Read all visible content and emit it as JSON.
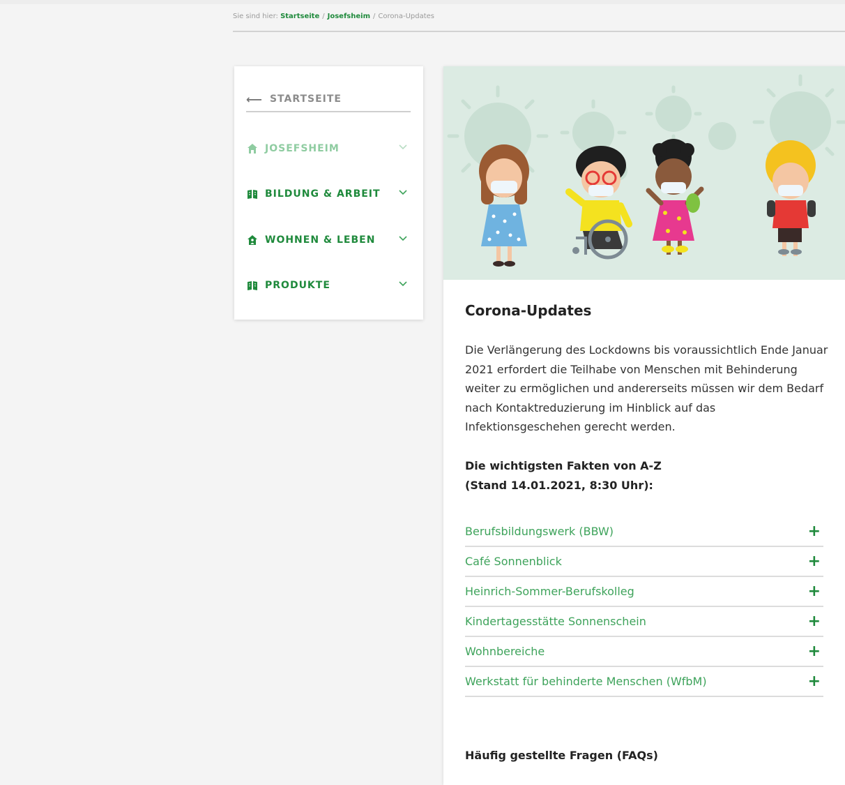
{
  "breadcrumb": {
    "prefix": "Sie sind hier:",
    "items": [
      "Startseite",
      "Josefsheim",
      "Corona-Updates"
    ],
    "separator": "/"
  },
  "sidebar": {
    "back_label": "STARTSEITE",
    "back_icon": "arrow-left-icon",
    "items": [
      {
        "label": "JOSEFSHEIM",
        "icon": "home-icon"
      },
      {
        "label": "BILDUNG & ARBEIT",
        "icon": "book-icon"
      },
      {
        "label": "WOHNEN & LEBEN",
        "icon": "house-person-icon"
      },
      {
        "label": "PRODUKTE",
        "icon": "book-icon"
      }
    ]
  },
  "hero": {
    "image": "children-with-masks-illustration"
  },
  "article": {
    "title": "Corona-Updates",
    "intro": "Die Verlängerung des Lockdowns bis voraussichtlich Ende Januar 2021 erfordert die Teilhabe von Menschen mit Behinderung weiter zu ermöglichen und andererseits müssen wir dem Bedarf nach Kontaktreduzierung im Hinblick auf das Infektionsgeschehen gerecht werden.",
    "facts_line1": "Die wichtigsten Fakten von A-Z",
    "facts_line2": "(Stand 14.01.2021, 8:30 Uhr):"
  },
  "accordion": {
    "expand_symbol": "+",
    "items": [
      "Berufsbildungswerk (BBW)",
      "Café Sonnenblick",
      "Heinrich-Sommer-Berufskolleg",
      "Kindertagesstätte Sonnenschein",
      "Wohnbereiche",
      "Werkstatt für behinderte Menschen (WfbM)"
    ]
  },
  "faq": {
    "title": "Häufig gestellte Fragen (FAQs)"
  },
  "colors": {
    "accent_green": "#1f8a3c",
    "link_green": "#3ea35b",
    "light_green": "#8fcca1",
    "hero_bg": "#dcebe3",
    "page_bg": "#f4f4f4"
  }
}
